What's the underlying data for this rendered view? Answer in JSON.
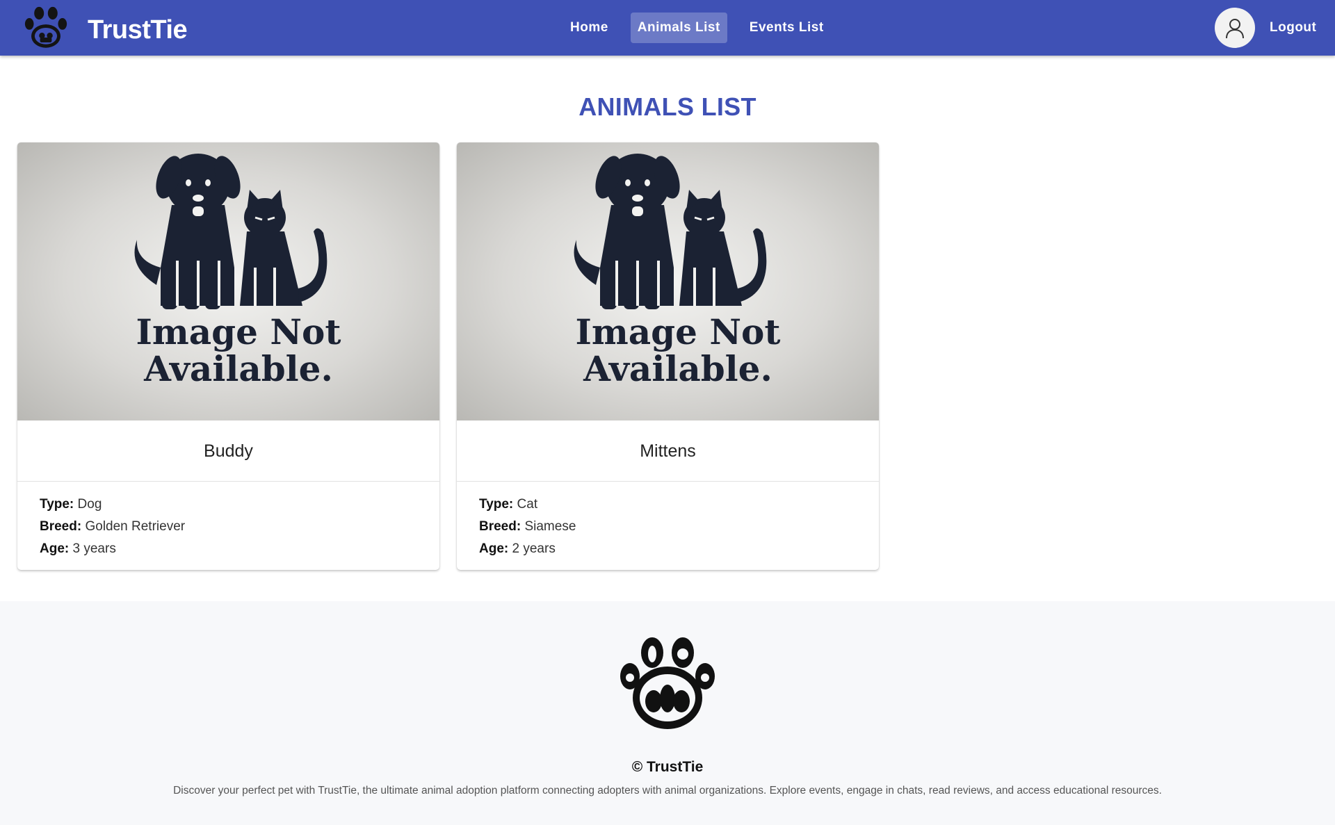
{
  "brand": {
    "name": "TrustTie",
    "logo_icon": "paw-animals-logo-icon"
  },
  "nav": {
    "links": [
      {
        "label": "Home",
        "active": false
      },
      {
        "label": "Animals List",
        "active": true
      },
      {
        "label": "Events List",
        "active": false
      }
    ],
    "avatar_icon": "user-icon",
    "logout_label": "Logout"
  },
  "page": {
    "heading": "ANIMALS LIST"
  },
  "image_placeholder": {
    "line1": "Image Not",
    "line2": "Available."
  },
  "animals": [
    {
      "name": "Buddy",
      "type_label": "Type:",
      "type": "Dog",
      "breed_label": "Breed:",
      "breed": "Golden Retriever",
      "age_label": "Age:",
      "age": "3 years"
    },
    {
      "name": "Mittens",
      "type_label": "Type:",
      "type": "Cat",
      "breed_label": "Breed:",
      "breed": "Siamese",
      "age_label": "Age:",
      "age": "2 years"
    }
  ],
  "footer": {
    "title": "© TrustTie",
    "description": "Discover your perfect pet with TrustTie, the ultimate animal adoption platform connecting adopters with animal organizations. Explore events, engage in chats, read reviews, and access educational resources."
  },
  "colors": {
    "primary": "#3f51b5",
    "footer_bg": "#f7f8fa",
    "silhouette": "#1b2233"
  }
}
